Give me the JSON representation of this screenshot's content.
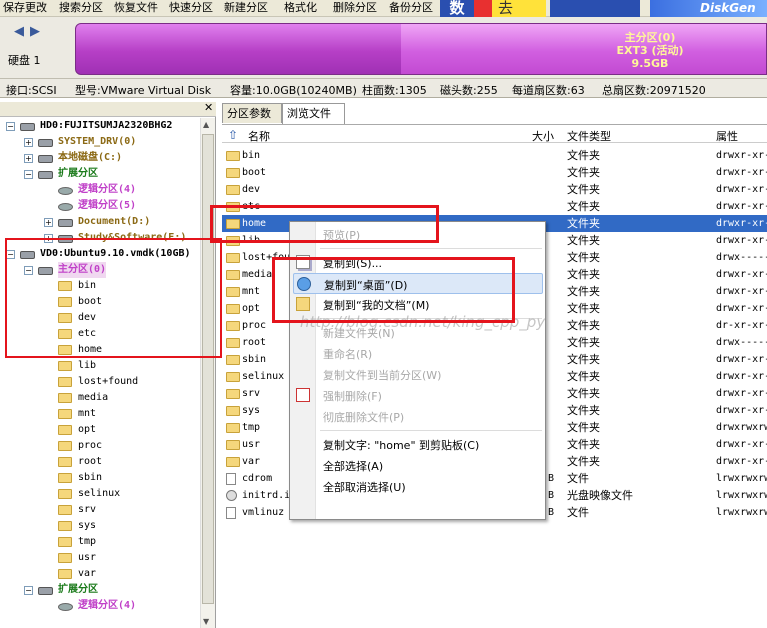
{
  "toolbar": {
    "items": [
      "保存更改",
      "搜索分区",
      "恢复文件",
      "快速分区",
      "新建分区",
      "格式化",
      "删除分区",
      "备份分区"
    ],
    "banner_text": [
      "数",
      "去",
      "DiskGen"
    ]
  },
  "disk": {
    "nav_back": "◀",
    "nav_forward": "▶",
    "label": "硬盘 1",
    "partition_name": "主分区(0)",
    "partition_fs": "EXT3 (活动)",
    "partition_size": "9.5GB"
  },
  "info": {
    "iface": "接口:SCSI",
    "model": "型号:VMware Virtual Disk",
    "capacity": "容量:10.0GB(10240MB)",
    "cylinders": "柱面数:1305",
    "heads": "磁头数:255",
    "sectors_per_track": "每道扇区数:63",
    "total_sectors": "总扇区数:20971520"
  },
  "tree": {
    "close": "✕",
    "nodes": [
      {
        "label": "HD0:FUJITSUMJA2320BHG2",
        "level": 0,
        "style": "black",
        "icon": "hdd",
        "pm": "−"
      },
      {
        "label": "SYSTEM_DRV(0)",
        "level": 1,
        "style": "brown",
        "icon": "hdd",
        "pm": "+"
      },
      {
        "label": "本地磁盘(C:)",
        "level": 1,
        "style": "brown",
        "icon": "hdd",
        "pm": "+"
      },
      {
        "label": "扩展分区",
        "level": 1,
        "style": "green",
        "icon": "hdd",
        "pm": "−"
      },
      {
        "label": "逻辑分区(4)",
        "level": 2,
        "style": "pink",
        "icon": "hddg",
        "pm": ""
      },
      {
        "label": "逻辑分区(5)",
        "level": 2,
        "style": "pink",
        "icon": "hddg",
        "pm": ""
      },
      {
        "label": "Document(D:)",
        "level": 2,
        "style": "brown",
        "icon": "hdd",
        "pm": "+"
      },
      {
        "label": "Study&Software(E:)",
        "level": 2,
        "style": "brown",
        "icon": "hdd",
        "pm": "+"
      },
      {
        "label": "VD0:Ubuntu9.10.vmdk(10GB)",
        "level": 0,
        "style": "black",
        "icon": "hdd",
        "pm": "−"
      },
      {
        "label": "主分区(0)",
        "level": 1,
        "style": "pink",
        "icon": "hdd",
        "pm": "−"
      },
      {
        "label": "bin",
        "level": 2,
        "style": "plain",
        "icon": "folder",
        "pm": ""
      },
      {
        "label": "boot",
        "level": 2,
        "style": "plain",
        "icon": "folder",
        "pm": ""
      },
      {
        "label": "dev",
        "level": 2,
        "style": "plain",
        "icon": "folder",
        "pm": ""
      },
      {
        "label": "etc",
        "level": 2,
        "style": "plain",
        "icon": "folder",
        "pm": ""
      },
      {
        "label": "home",
        "level": 2,
        "style": "plain",
        "icon": "folder",
        "pm": ""
      },
      {
        "label": "lib",
        "level": 2,
        "style": "plain",
        "icon": "folder",
        "pm": ""
      },
      {
        "label": "lost+found",
        "level": 2,
        "style": "plain",
        "icon": "folder",
        "pm": ""
      },
      {
        "label": "media",
        "level": 2,
        "style": "plain",
        "icon": "folder",
        "pm": ""
      },
      {
        "label": "mnt",
        "level": 2,
        "style": "plain",
        "icon": "folder",
        "pm": ""
      },
      {
        "label": "opt",
        "level": 2,
        "style": "plain",
        "icon": "folder",
        "pm": ""
      },
      {
        "label": "proc",
        "level": 2,
        "style": "plain",
        "icon": "folder",
        "pm": ""
      },
      {
        "label": "root",
        "level": 2,
        "style": "plain",
        "icon": "folder",
        "pm": ""
      },
      {
        "label": "sbin",
        "level": 2,
        "style": "plain",
        "icon": "folder",
        "pm": ""
      },
      {
        "label": "selinux",
        "level": 2,
        "style": "plain",
        "icon": "folder",
        "pm": ""
      },
      {
        "label": "srv",
        "level": 2,
        "style": "plain",
        "icon": "folder",
        "pm": ""
      },
      {
        "label": "sys",
        "level": 2,
        "style": "plain",
        "icon": "folder",
        "pm": ""
      },
      {
        "label": "tmp",
        "level": 2,
        "style": "plain",
        "icon": "folder",
        "pm": ""
      },
      {
        "label": "usr",
        "level": 2,
        "style": "plain",
        "icon": "folder",
        "pm": ""
      },
      {
        "label": "var",
        "level": 2,
        "style": "plain",
        "icon": "folder",
        "pm": ""
      },
      {
        "label": "扩展分区",
        "level": 1,
        "style": "green",
        "icon": "hdd",
        "pm": "−"
      },
      {
        "label": "逻辑分区(4)",
        "level": 2,
        "style": "pink",
        "icon": "hddg",
        "pm": ""
      }
    ]
  },
  "tabs": [
    "分区参数",
    "浏览文件"
  ],
  "columns": {
    "up": "⇧",
    "name": "名称",
    "size": "大小",
    "type": "文件类型",
    "attr": "属性"
  },
  "files": [
    {
      "name": "bin",
      "size": "",
      "type": "文件夹",
      "attr": "drwxr-xr-x",
      "icon": "folder"
    },
    {
      "name": "boot",
      "size": "",
      "type": "文件夹",
      "attr": "drwxr-xr-x",
      "icon": "folder"
    },
    {
      "name": "dev",
      "size": "",
      "type": "文件夹",
      "attr": "drwxr-xr-x",
      "icon": "folder"
    },
    {
      "name": "etc",
      "size": "",
      "type": "文件夹",
      "attr": "drwxr-xr-x",
      "icon": "folder"
    },
    {
      "name": "home",
      "size": "",
      "type": "文件夹",
      "attr": "drwxr-xr-x",
      "icon": "folder",
      "selected": true
    },
    {
      "name": "lib",
      "size": "",
      "type": "文件夹",
      "attr": "drwxr-xr-x",
      "icon": "folder"
    },
    {
      "name": "lost+found",
      "size": "",
      "type": "文件夹",
      "attr": "drwx------",
      "icon": "folder"
    },
    {
      "name": "media",
      "size": "",
      "type": "文件夹",
      "attr": "drwxr-xr-x",
      "icon": "folder"
    },
    {
      "name": "mnt",
      "size": "",
      "type": "文件夹",
      "attr": "drwxr-xr-x",
      "icon": "folder"
    },
    {
      "name": "opt",
      "size": "",
      "type": "文件夹",
      "attr": "drwxr-xr-x",
      "icon": "folder"
    },
    {
      "name": "proc",
      "size": "",
      "type": "文件夹",
      "attr": "dr-xr-xr-x",
      "icon": "folder"
    },
    {
      "name": "root",
      "size": "",
      "type": "文件夹",
      "attr": "drwx------",
      "icon": "folder"
    },
    {
      "name": "sbin",
      "size": "",
      "type": "文件夹",
      "attr": "drwxr-xr-x",
      "icon": "folder"
    },
    {
      "name": "selinux",
      "size": "",
      "type": "文件夹",
      "attr": "drwxr-xr-x",
      "icon": "folder"
    },
    {
      "name": "srv",
      "size": "",
      "type": "文件夹",
      "attr": "drwxr-xr-x",
      "icon": "folder"
    },
    {
      "name": "sys",
      "size": "",
      "type": "文件夹",
      "attr": "drwxr-xr-x",
      "icon": "folder"
    },
    {
      "name": "tmp",
      "size": "",
      "type": "文件夹",
      "attr": "drwxrwxrwt",
      "icon": "folder"
    },
    {
      "name": "usr",
      "size": "",
      "type": "文件夹",
      "attr": "drwxr-xr-x",
      "icon": "folder"
    },
    {
      "name": "var",
      "size": "",
      "type": "文件夹",
      "attr": "drwxr-xr-x",
      "icon": "folder"
    },
    {
      "name": "cdrom",
      "size": "B",
      "type": "文件",
      "attr": "lrwxrwxrwx",
      "icon": "file"
    },
    {
      "name": "initrd.img",
      "size": "B",
      "type": "光盘映像文件",
      "attr": "lrwxrwxrwx",
      "icon": "disc"
    },
    {
      "name": "vmlinuz",
      "size": "B",
      "type": "文件",
      "attr": "lrwxrwxrwx",
      "icon": "file"
    }
  ],
  "context_menu": [
    {
      "label": "预览(P)",
      "disabled": true,
      "icon": ""
    },
    {
      "sep": true
    },
    {
      "label": "复制到(S)...",
      "disabled": false,
      "icon": "copy"
    },
    {
      "label": "复制到“桌面”(D)",
      "disabled": false,
      "icon": "desktop",
      "highlight": true
    },
    {
      "label": "复制到“我的文档”(M)",
      "disabled": false,
      "icon": "docs"
    },
    {
      "sep": true
    },
    {
      "label": "新建文件夹(N)",
      "disabled": true,
      "icon": ""
    },
    {
      "label": "重命名(R)",
      "disabled": true,
      "icon": ""
    },
    {
      "label": "复制文件到当前分区(W)",
      "disabled": true,
      "icon": ""
    },
    {
      "label": "强制删除(F)",
      "disabled": true,
      "icon": "del"
    },
    {
      "label": "彻底删除文件(P)",
      "disabled": true,
      "icon": ""
    },
    {
      "sep": true
    },
    {
      "label": "复制文字: \"home\" 到剪贴板(C)",
      "disabled": false,
      "icon": ""
    },
    {
      "label": "全部选择(A)",
      "disabled": false,
      "icon": ""
    },
    {
      "label": "全部取消选择(U)",
      "disabled": false,
      "icon": ""
    }
  ],
  "watermark": "http://blog.csdn.net/king_cpp_py",
  "colors": {
    "selection": "#316ac5",
    "annotation": "#e4141c",
    "partition_bar": "#b63fc6",
    "partition_text": "#fff799"
  }
}
